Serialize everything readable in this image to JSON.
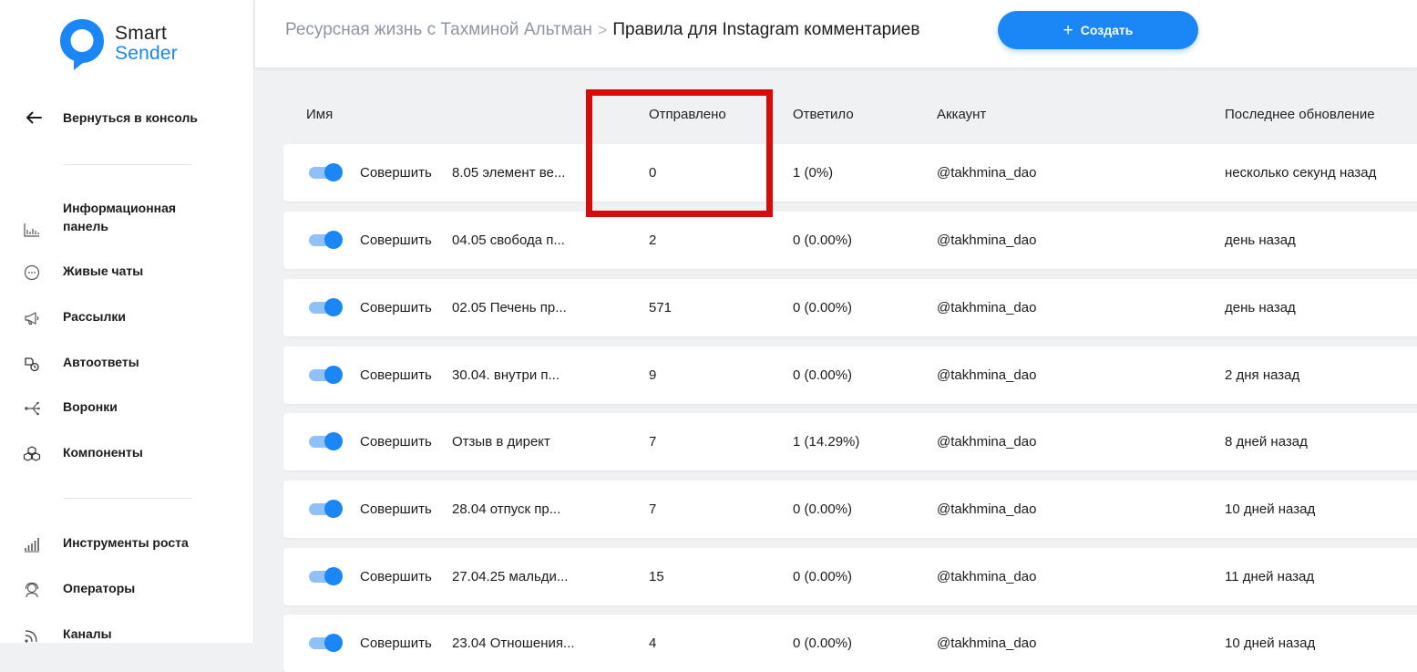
{
  "brand": {
    "line1": "Smart",
    "line2": "Sender",
    "accent": "#1b86f5"
  },
  "sidebar": {
    "back_label": "Вернуться в консоль",
    "items": [
      {
        "label": "Информационная панель",
        "icon": "bar-chart-icon"
      },
      {
        "label": "Живые чаты",
        "icon": "chat-bubble-icon"
      },
      {
        "label": "Рассылки",
        "icon": "megaphone-icon"
      },
      {
        "label": "Автоответы",
        "icon": "auto-reply-icon"
      },
      {
        "label": "Воронки",
        "icon": "funnel-branch-icon"
      },
      {
        "label": "Компоненты",
        "icon": "cubes-icon"
      },
      {
        "label": "Инструменты роста",
        "icon": "growth-bars-icon"
      },
      {
        "label": "Операторы",
        "icon": "operator-icon"
      },
      {
        "label": "Каналы",
        "icon": "rss-icon"
      }
    ]
  },
  "header": {
    "breadcrumb_parent": "Ресурсная жизнь с Тахминой Альтман",
    "breadcrumb_separator": ">",
    "breadcrumb_current": "Правила для Instagram комментариев",
    "create_label": "Создать"
  },
  "table": {
    "columns": [
      "Имя",
      "Отправлено",
      "Ответило",
      "Аккаунт",
      "Последнее обновление"
    ],
    "action_label": "Совершить",
    "rows": [
      {
        "name": "8.05 элемент ве...",
        "sent": "0",
        "replied": "1 (0%)",
        "account": "@takhmina_dao",
        "updated": "несколько секунд назад",
        "enabled": true
      },
      {
        "name": "04.05 свобода п...",
        "sent": "2",
        "replied": "0 (0.00%)",
        "account": "@takhmina_dao",
        "updated": "день назад",
        "enabled": true
      },
      {
        "name": "02.05 Печень пр...",
        "sent": "571",
        "replied": "0 (0.00%)",
        "account": "@takhmina_dao",
        "updated": "день назад",
        "enabled": true
      },
      {
        "name": "30.04. внутри п...",
        "sent": "9",
        "replied": "0 (0.00%)",
        "account": "@takhmina_dao",
        "updated": "2 дня назад",
        "enabled": true
      },
      {
        "name": "Отзыв в директ",
        "sent": "7",
        "replied": "1 (14.29%)",
        "account": "@takhmina_dao",
        "updated": "8 дней назад",
        "enabled": true
      },
      {
        "name": "28.04 отпуск пр...",
        "sent": "7",
        "replied": "0 (0.00%)",
        "account": "@takhmina_dao",
        "updated": "10 дней назад",
        "enabled": true
      },
      {
        "name": "27.04.25 мальди...",
        "sent": "15",
        "replied": "0 (0.00%)",
        "account": "@takhmina_dao",
        "updated": "11 дней назад",
        "enabled": true
      },
      {
        "name": "23.04 Отношения...",
        "sent": "4",
        "replied": "0 (0.00%)",
        "account": "@takhmina_dao",
        "updated": "10 дней назад",
        "enabled": true
      }
    ]
  },
  "annotation_color": "#d40c0c"
}
